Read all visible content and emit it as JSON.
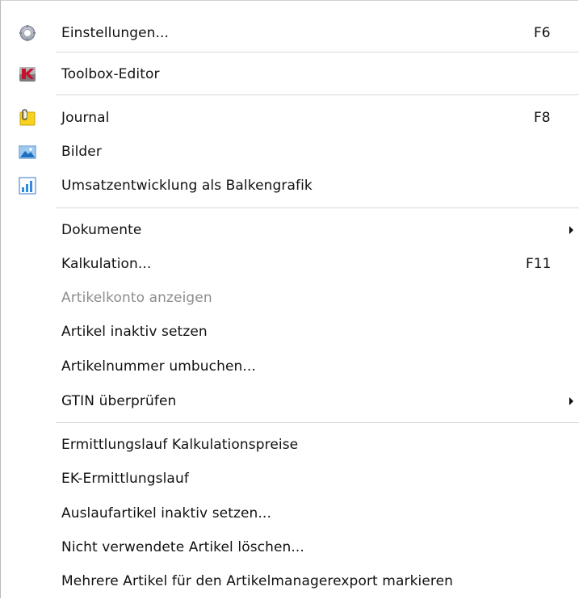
{
  "menu": {
    "items": [
      {
        "label": "Einstellungen...",
        "shortcut": "F6",
        "icon": "gear-icon"
      },
      {
        "label": "Toolbox-Editor",
        "shortcut": "",
        "icon": "toolbox-icon"
      },
      {
        "label": "Journal",
        "shortcut": "F8",
        "icon": "journal-icon"
      },
      {
        "label": "Bilder",
        "shortcut": "",
        "icon": "pictures-icon"
      },
      {
        "label": "Umsatzentwicklung als Balkengrafik",
        "shortcut": "",
        "icon": "bar-chart-icon"
      },
      {
        "label": "Dokumente",
        "shortcut": "",
        "submenu": true
      },
      {
        "label": "Kalkulation...",
        "shortcut": "F11"
      },
      {
        "label": "Artikelkonto anzeigen",
        "shortcut": "",
        "disabled": true
      },
      {
        "label": "Artikel inaktiv setzen",
        "shortcut": ""
      },
      {
        "label": "Artikelnummer umbuchen...",
        "shortcut": ""
      },
      {
        "label": "GTIN überprüfen",
        "shortcut": "",
        "submenu": true
      },
      {
        "label": "Ermittlungslauf Kalkulationspreise",
        "shortcut": ""
      },
      {
        "label": "EK-Ermittlungslauf",
        "shortcut": ""
      },
      {
        "label": "Auslaufartikel inaktiv setzen...",
        "shortcut": ""
      },
      {
        "label": "Nicht verwendete Artikel löschen...",
        "shortcut": ""
      },
      {
        "label": "Mehrere Artikel für den Artikelmanagerexport markieren",
        "shortcut": ""
      }
    ]
  }
}
